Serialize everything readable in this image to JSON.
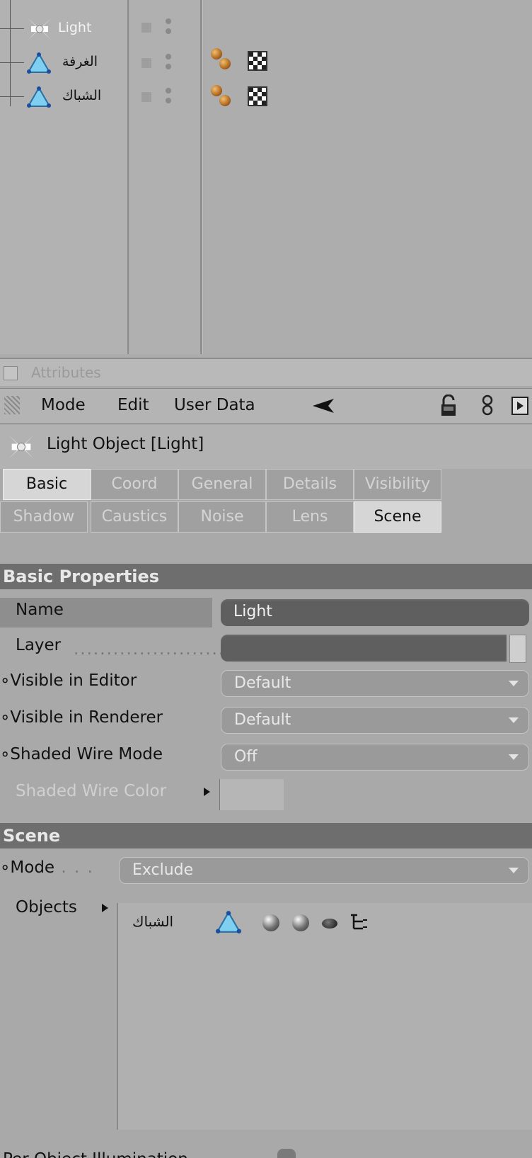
{
  "object_manager": {
    "objects": [
      {
        "name": "Light",
        "icon": "light-icon"
      },
      {
        "name": "الغرفة",
        "icon": "polygon-object-icon"
      },
      {
        "name": "الشباك",
        "icon": "polygon-object-icon"
      }
    ]
  },
  "attributes": {
    "panel_title": "Attributes",
    "menu": [
      "Mode",
      "Edit",
      "User Data"
    ],
    "object_title": "Light Object [Light]",
    "tabs_row1": [
      "Basic",
      "Coord",
      "General",
      "Details",
      "Visibility"
    ],
    "tabs_row2": [
      "Shadow",
      "Caustics",
      "Noise",
      "Lens",
      "Scene"
    ],
    "active_tabs": [
      "Basic",
      "Scene"
    ],
    "basic_section": "Basic Properties",
    "basic": {
      "name_label": "Name",
      "name_value": "Light",
      "layer_label": "Layer",
      "visible_editor_label": "Visible in Editor",
      "visible_editor_value": "Default",
      "visible_renderer_label": "Visible in Renderer",
      "visible_renderer_value": "Default",
      "shaded_wire_label": "Shaded Wire Mode",
      "shaded_wire_value": "Off",
      "shaded_wire_color_label": "Shaded Wire Color"
    },
    "scene_section": "Scene",
    "scene": {
      "mode_label": "Mode",
      "mode_value": "Exclude",
      "objects_label": "Objects",
      "object_entry": "الشباك"
    },
    "footer_partial": "Per Object Illumination"
  }
}
